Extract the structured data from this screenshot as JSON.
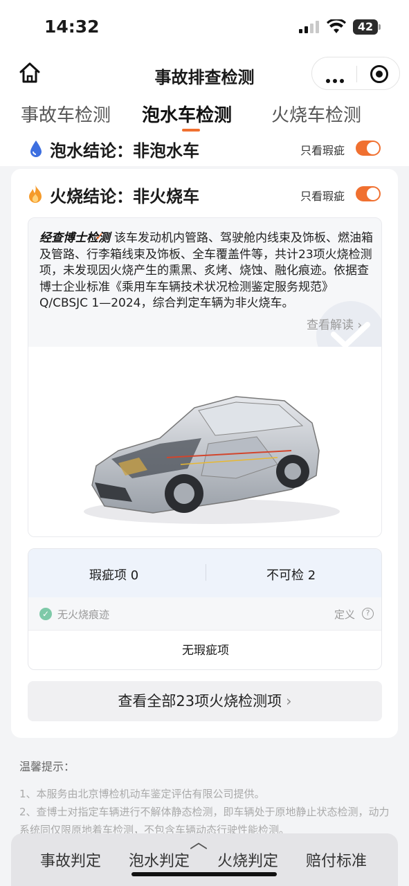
{
  "status_bar": {
    "time": "14:32",
    "battery": "42"
  },
  "nav": {
    "title": "事故排查检测"
  },
  "tabs": [
    {
      "label": "事故车检测"
    },
    {
      "label": "泡水车检测",
      "active": true
    },
    {
      "label": "火烧车检测"
    }
  ],
  "water": {
    "conclusion": "泡水结论：非泡水车",
    "filter_label": "只看瑕疵",
    "filter_on": true
  },
  "fire": {
    "conclusion": "火烧结论：非火烧车",
    "filter_label": "只看瑕疵",
    "filter_on": true,
    "report_brand": "经查博士检测",
    "report_text": "该车发动机内管路、驾驶舱内线束及饰板、燃油箱及管路、行李箱线束及饰板、全车覆盖件等，共计23项火烧检测项，未发现因火烧产生的熏黑、炙烤、烧蚀、融化痕迹。依据查博士企业标准《乘用车车辆技术状况检测鉴定服务规范》Q/CBSJC 1—2024，综合判定车辆为非火烧车。",
    "read_more": "查看解读",
    "defect_label": "瑕疵项 0",
    "uncheckable_label": "不可检 2",
    "trace_label": "无火烧痕迹",
    "definition_label": "定义",
    "no_defect": "无瑕疵项",
    "view_all": "查看全部23项火烧检测项"
  },
  "tips": {
    "title": "温馨提示：",
    "items": [
      "1、本服务由北京博检机动车鉴定评估有限公司提供。",
      "2、查博士对指定车辆进行不解体静态检测，即车辆处于原地静止状态检测，动力系统同仅限原地着车检测，不包含车辆动态行驶性能检测。"
    ]
  },
  "bottom_nav": [
    {
      "label": "事故判定"
    },
    {
      "label": "泡水判定"
    },
    {
      "label": "火烧判定"
    },
    {
      "label": "赔付标准"
    }
  ],
  "colors": {
    "accent": "#f07030",
    "water_icon": "#3d6fe0",
    "fire_icon": "#f59a2a",
    "success": "#7ec9a8"
  }
}
